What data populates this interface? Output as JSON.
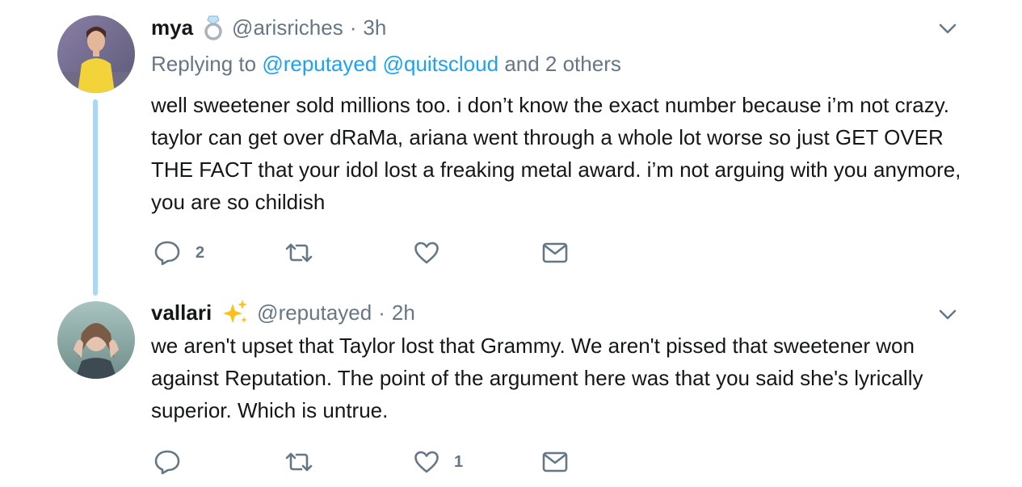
{
  "tweets": [
    {
      "name": "mya",
      "name_emoji": "ring-icon",
      "handle": "@arisriches",
      "separator": "·",
      "time": "3h",
      "replying_prefix": "Replying to",
      "replying_mentions": [
        "@reputayed",
        "@quitscloud"
      ],
      "replying_suffix": "and 2 others",
      "text": "well sweetener sold millions too. i don’t know the exact number because i’m not crazy. taylor can get over dRaMa, ariana went through a whole lot worse so just GET OVER THE FACT that your idol lost a freaking metal award. i’m not arguing with you anymore, you are so childish",
      "actions": {
        "replies": "2",
        "retweets": "",
        "likes": ""
      }
    },
    {
      "name": "vallari",
      "name_emoji": "sparkles-icon",
      "handle": "@reputayed",
      "separator": "·",
      "time": "2h",
      "text": "we aren't upset that Taylor lost that Grammy. We aren't pissed that sweetener won against Reputation. The point of the argument here was that you said she's lyrically superior. Which is untrue.",
      "actions": {
        "replies": "",
        "retweets": "",
        "likes": "1"
      }
    }
  ],
  "colors": {
    "text": "#14171a",
    "secondary": "#657786",
    "link": "#1da1f2",
    "thread_line": "#a7d8f8"
  }
}
